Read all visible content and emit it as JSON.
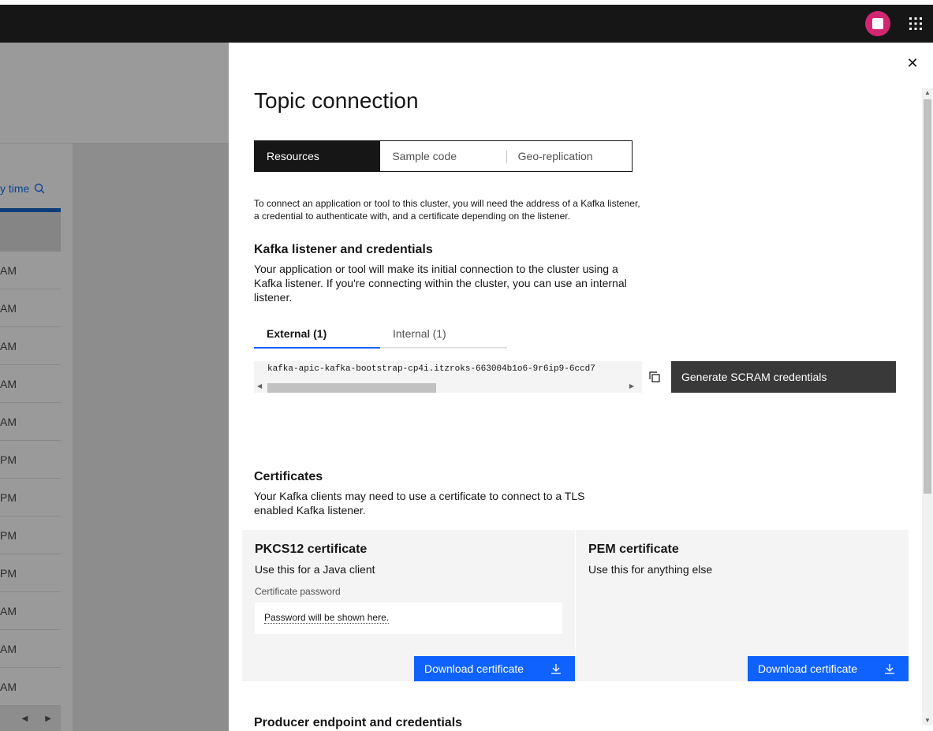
{
  "background": {
    "search_label": "y time",
    "rows": [
      "AM",
      "AM",
      "AM",
      "AM",
      "AM",
      "PM",
      "PM",
      "PM",
      "PM",
      "AM",
      "AM",
      "AM"
    ]
  },
  "panel": {
    "title": "Topic connection",
    "switcher": [
      {
        "label": "Resources",
        "active": true
      },
      {
        "label": "Sample code",
        "active": false
      },
      {
        "label": "Geo-replication",
        "active": false
      }
    ],
    "intro": "To connect an application or tool to this cluster, you will need the address of a Kafka listener, a credential to authenticate with, and a certificate depending on the listener.",
    "listener": {
      "heading": "Kafka listener and credentials",
      "description": "Your application or tool will make its initial connection to the cluster using a Kafka listener. If you're connecting within the cluster, you can use an internal listener.",
      "tabs": [
        {
          "label": "External (1)",
          "active": true
        },
        {
          "label": "Internal (1)",
          "active": false
        }
      ],
      "address": "kafka-apic-kafka-bootstrap-cp4i.itzroks-663004b1o6-9r6ip9-6ccd7",
      "generate_button": "Generate SCRAM credentials"
    },
    "certificates": {
      "heading": "Certificates",
      "description": "Your Kafka clients may need to use a certificate to connect to a TLS enabled Kafka listener.",
      "pkcs12": {
        "title": "PKCS12 certificate",
        "description": "Use this for a Java client",
        "password_label": "Certificate password",
        "password_placeholder": "Password will be shown here.",
        "download_label": "Download certificate"
      },
      "pem": {
        "title": "PEM certificate",
        "description": "Use this for anything else",
        "download_label": "Download certificate"
      }
    },
    "producer_heading": "Producer endpoint and credentials"
  },
  "colors": {
    "primary": "#0f62fe",
    "dark": "#161616",
    "avatar": "#d12771"
  }
}
